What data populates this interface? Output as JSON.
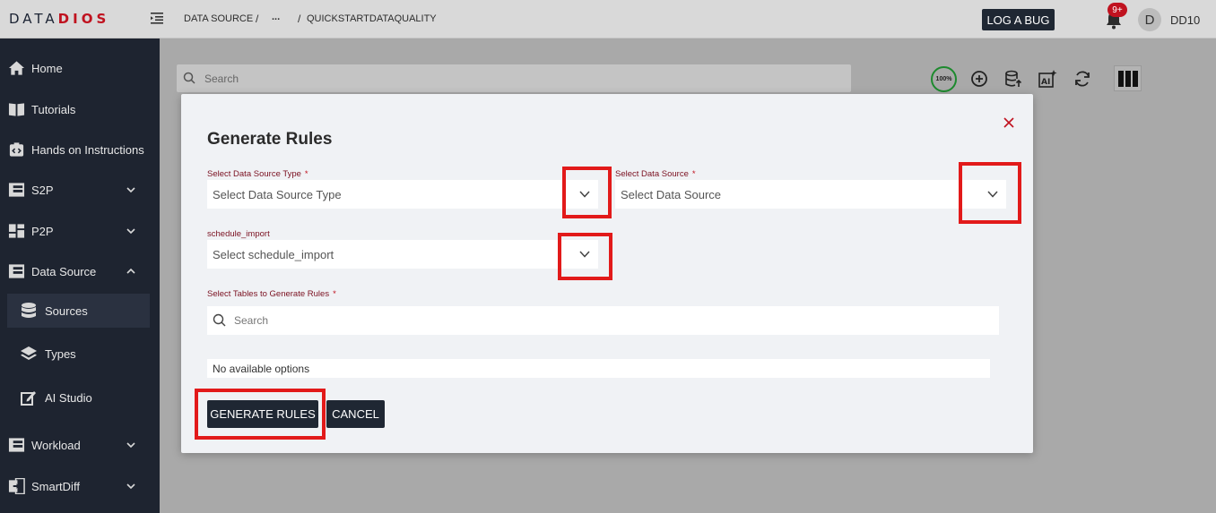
{
  "header": {
    "logo_left": "DATA",
    "logo_right": "DIOS",
    "breadcrumb": [
      "DATA SOURCE",
      "...",
      "QUICKSTARTDATAQUALITY"
    ],
    "breadcrumb_sep": "/",
    "log_bug_label": "LOG A BUG",
    "notification_badge": "9+",
    "avatar_letter": "D",
    "username": "DD10"
  },
  "sidebar": {
    "items": [
      {
        "label": "Home",
        "icon": "home-icon"
      },
      {
        "label": "Tutorials",
        "icon": "book-icon"
      },
      {
        "label": "Hands on Instructions",
        "icon": "code-box-icon"
      },
      {
        "label": "S2P",
        "icon": "columns-icon",
        "expandable": true
      },
      {
        "label": "P2P",
        "icon": "grid-icon",
        "expandable": true
      },
      {
        "label": "Data Source",
        "icon": "table-icon",
        "expandable": true,
        "expanded": true
      },
      {
        "label": "Workload",
        "icon": "table-icon",
        "expandable": true
      },
      {
        "label": "SmartDiff",
        "icon": "diff-icon",
        "expandable": true
      }
    ],
    "sub_items": [
      {
        "label": "Sources",
        "icon": "database-icon",
        "active": true
      },
      {
        "label": "Types",
        "icon": "layers-icon"
      },
      {
        "label": "AI Studio",
        "icon": "edit-icon"
      }
    ]
  },
  "background": {
    "search_placeholder": "Search",
    "quality_percent": "100%"
  },
  "modal": {
    "title": "Generate Rules",
    "data_source_type": {
      "label": "Select Data Source Type",
      "placeholder": "Select Data Source Type",
      "required": true
    },
    "data_source": {
      "label": "Select Data Source",
      "placeholder": "Select Data Source",
      "required": true
    },
    "schedule_import": {
      "label": "schedule_import",
      "placeholder": "Select schedule_import"
    },
    "tables": {
      "label": "Select Tables to Generate Rules",
      "required": true,
      "search_placeholder": "Search"
    },
    "no_options": "No available options",
    "generate_label": "GENERATE RULES",
    "cancel_label": "CANCEL"
  },
  "colors": {
    "sidebar_bg": "#1e2430",
    "accent_red": "#c0121f",
    "highlight_red": "#e21a1a",
    "button_dark": "#1f2733"
  }
}
